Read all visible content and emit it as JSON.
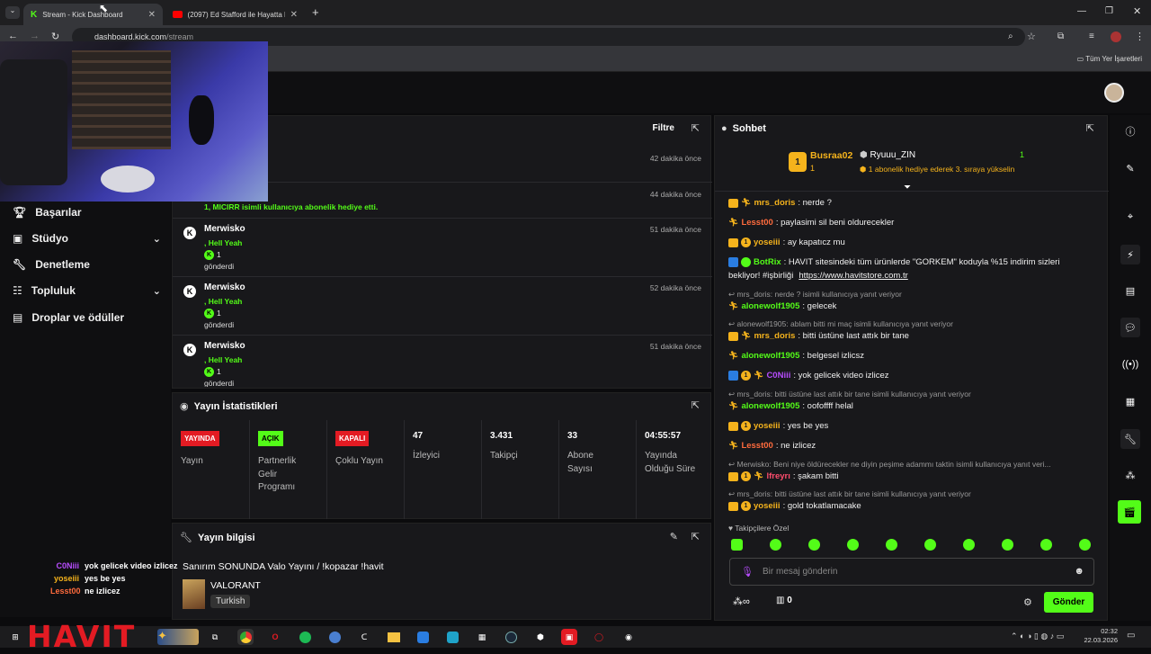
{
  "browser": {
    "tabs": [
      {
        "label": "Stream - Kick Dashboard",
        "active": true
      },
      {
        "label": "(2097) Ed Stafford ile Hayatta K",
        "active": false
      }
    ],
    "url_host": "dashboard.kick.com",
    "url_path": "/stream",
    "bookmarks_label": "Tüm Yer İşaretleri"
  },
  "sidebar": {
    "items": [
      {
        "label": "Başarılar",
        "icon": "trophy-icon"
      },
      {
        "label": "Stüdyo",
        "icon": "studio-icon"
      },
      {
        "label": "Denetleme",
        "icon": "wrench-icon"
      },
      {
        "label": "Topluluk",
        "icon": "community-icon"
      },
      {
        "label": "Droplar ve ödüller",
        "icon": "gift-icon"
      }
    ]
  },
  "activity": {
    "filter_label": "Filtre",
    "rows": [
      {
        "name": "",
        "time": "42 dakika önce"
      },
      {
        "name": "",
        "time": "44 dakika önce",
        "gift_text": "1, MICIRR isimli kullanıcıya abonelik hediye etti."
      },
      {
        "name": "Merwisko",
        "time": "51 dakika önce",
        "emote": ", Hell Yeah",
        "count": "1",
        "sent": "gönderdi"
      },
      {
        "name": "Merwisko",
        "time": "52 dakika önce",
        "emote": ", Hell Yeah",
        "count": "1",
        "sent": "gönderdi"
      },
      {
        "name": "Merwisko",
        "time": "51 dakika önce",
        "emote": ", Hell Yeah",
        "count": "1",
        "sent": "gönderdi"
      }
    ]
  },
  "stats": {
    "title": "Yayın İstatistikleri",
    "columns": [
      {
        "badge": "YAYINDA",
        "badge_color": "#e31b23",
        "label": "Yayın"
      },
      {
        "badge": "AÇIK",
        "badge_color": "#53fc18",
        "label": "Partnerlik Gelir Programı"
      },
      {
        "badge": "KAPALI",
        "badge_color": "#e31b23",
        "label": "Çoklu Yayın"
      },
      {
        "value": "47",
        "label": "İzleyici"
      },
      {
        "value": "3.431",
        "label": "Takipçi"
      },
      {
        "value": "33",
        "label": "Abone Sayısı"
      },
      {
        "value": "04:55:57",
        "label": "Yayında Olduğu Süre"
      }
    ]
  },
  "stream_info": {
    "title": "Yayın bilgisi",
    "stream_title": "Sanırım SONUNDA Valo Yayını / !kopazar !havit",
    "category": "VALORANT",
    "language": "Turkish"
  },
  "chat": {
    "title": "Sohbet",
    "leaderboard": {
      "first_user": "Busraa02",
      "first_count": "1",
      "second_user": "Ryuuu_ZIN",
      "second_count": "1",
      "note": "1 abonelik hediye ederek 3. sıraya yükselin"
    },
    "messages": [
      {
        "type": "msg",
        "user": "mrs_doris",
        "color": "#f5b31c",
        "text": ": nerde ?"
      },
      {
        "type": "msg",
        "user": "Lesst00",
        "color": "#ff6b3d",
        "text": ": paylasimi sil beni oldurecekler"
      },
      {
        "type": "msg",
        "user": "yoseiii",
        "color": "#f5b31c",
        "text": ": ay kapatıcz mu"
      },
      {
        "type": "msg",
        "user": "BotRix",
        "color": "#53fc18",
        "text": ": HAVIT sitesindeki tüm ürünlerde \"GORKEM\" koduyla %15 indirim sizleri"
      },
      {
        "type": "cont",
        "text": "bekliyor! #işbirliği",
        "link": "https://www.havitstore.com.tr"
      },
      {
        "type": "reply",
        "text": "mrs_doris: nerde ? isimli kullanıcıya yanıt veriyor"
      },
      {
        "type": "msg",
        "user": "alonewolf1905",
        "color": "#53fc18",
        "text": ": gelecek"
      },
      {
        "type": "reply",
        "text": "alonewolf1905: ablam bitti mi maç isimli kullanıcıya yanıt veriyor"
      },
      {
        "type": "msg",
        "user": "mrs_doris",
        "color": "#f5b31c",
        "text": ": bitti üstüne last attık bir tane"
      },
      {
        "type": "msg",
        "user": "alonewolf1905",
        "color": "#53fc18",
        "text": ": belgesel izlicsz"
      },
      {
        "type": "msg",
        "user": "C0Niii",
        "color": "#b84dff",
        "text": ": yok gelicek video izlicez"
      },
      {
        "type": "reply",
        "text": "mrs_doris: bitti üstüne last attık bir tane isimli kullanıcıya yanıt veriyor"
      },
      {
        "type": "msg",
        "user": "alonewolf1905",
        "color": "#53fc18",
        "text": ": oofoffff helal"
      },
      {
        "type": "msg",
        "user": "yoseiii",
        "color": "#f5b31c",
        "text": ": yes be yes"
      },
      {
        "type": "msg",
        "user": "Lesst00",
        "color": "#ff6b3d",
        "text": ": ne izlicez"
      },
      {
        "type": "reply",
        "text": "Merwisko: Beni niye öldürecekler ne diyin peşime adammı taktin isimli kullanıcıya yanıt veri..."
      },
      {
        "type": "msg",
        "user": "lfreyrı",
        "color": "#ff4d6d",
        "text": ": şakam bitti"
      },
      {
        "type": "reply",
        "text": "mrs_doris: bitti üstüne last attık bir tane isimli kullanıcıya yanıt veriyor"
      },
      {
        "type": "msg",
        "user": "yoseiii",
        "color": "#f5b31c",
        "text": ": gold tokatlamacake"
      }
    ],
    "followers_only": "Takipçilere Özel",
    "input_placeholder": "Bir mesaj gönderin",
    "points": "∞",
    "store_count": "0",
    "send_label": "Gönder"
  },
  "overlay": {
    "lines": [
      {
        "user": "C0Niii",
        "color": "#b84dff",
        "text": "yok gelicek video izlicez"
      },
      {
        "user": "yoseiii",
        "color": "#f5b31c",
        "text": "yes be yes"
      },
      {
        "user": "Lesst00",
        "color": "#ff6b3d",
        "text": "ne izlicez"
      }
    ],
    "logo": "HAVIT"
  },
  "taskbar": {
    "time": "02:32",
    "date": "22.03.2026"
  }
}
